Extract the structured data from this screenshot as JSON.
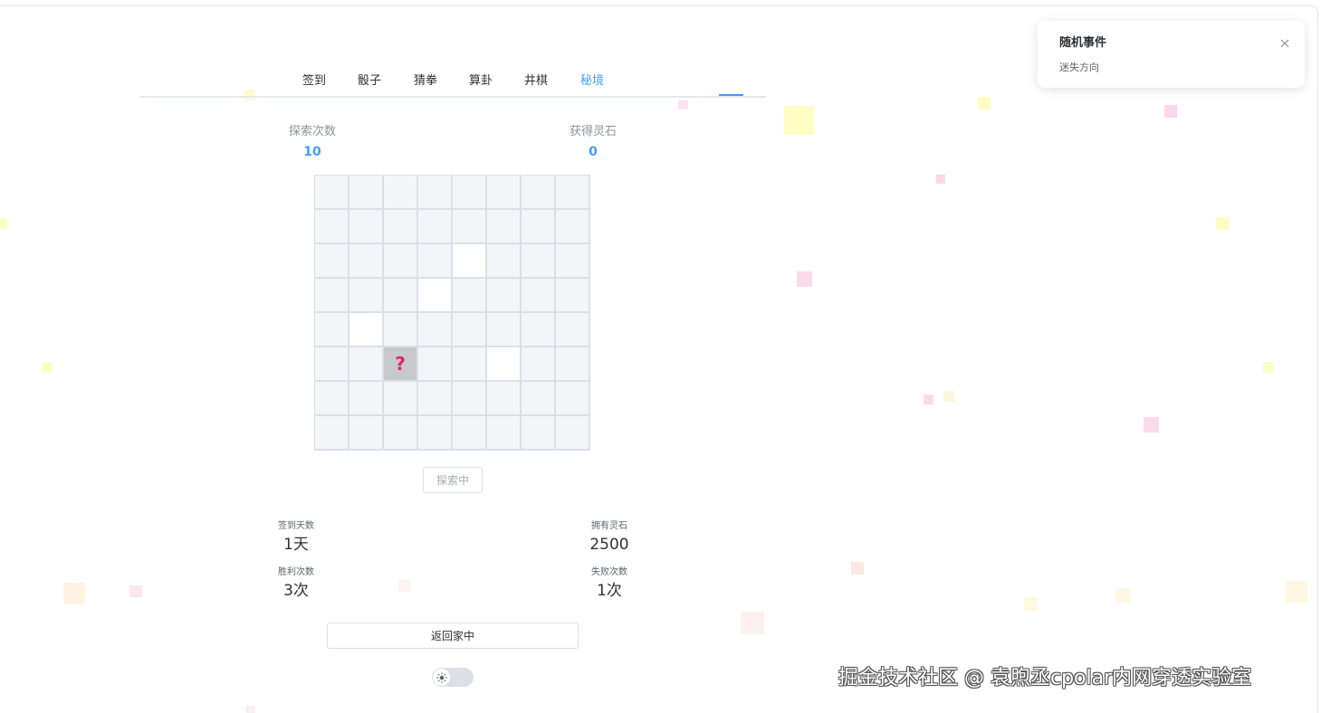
{
  "tabs": [
    {
      "label": "签到"
    },
    {
      "label": "骰子"
    },
    {
      "label": "猜拳"
    },
    {
      "label": "算卦"
    },
    {
      "label": "井棋"
    },
    {
      "label": "秘境"
    }
  ],
  "active_tab_index": 5,
  "colors": {
    "accent": "#409eff",
    "marker": "#e0245e"
  },
  "stats_top": {
    "explore_count": {
      "label": "探索次数",
      "value": "10"
    },
    "stones_gained": {
      "label": "获得灵石",
      "value": "0"
    }
  },
  "grid": {
    "rows": 8,
    "cols": 8,
    "explored_cells": [
      [
        2,
        4
      ],
      [
        3,
        3
      ],
      [
        4,
        1
      ],
      [
        5,
        5
      ]
    ],
    "current_cell": [
      5,
      2
    ],
    "current_marker": "?"
  },
  "explore_button": {
    "label": "探索中"
  },
  "stats_bottom": {
    "signin_days": {
      "label": "签到天数",
      "value": "1天"
    },
    "stones_owned": {
      "label": "拥有灵石",
      "value": "2500"
    },
    "wins": {
      "label": "胜利次数",
      "value": "3次"
    },
    "losses": {
      "label": "失败次数",
      "value": "1次"
    }
  },
  "home_button": {
    "label": "返回家中"
  },
  "theme_switch": {
    "icon": "sun-icon"
  },
  "notification": {
    "title": "随机事件",
    "message": "迷失方向",
    "close_icon": "close-icon"
  },
  "watermark": "掘金技术社区 @ 袁煦丞cpolar内网穿透实验室"
}
